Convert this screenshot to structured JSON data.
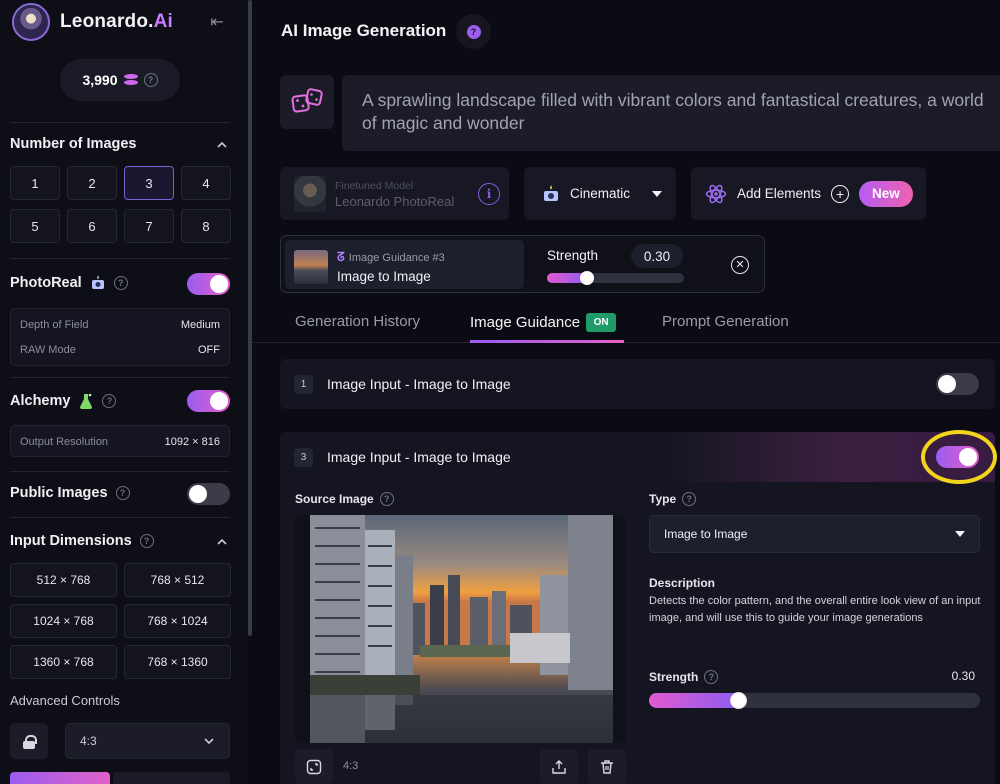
{
  "brand": {
    "name": "Leonardo.",
    "name_ai": "Ai"
  },
  "tokens": {
    "count": "3,990"
  },
  "sidebar": {
    "number_of_images": {
      "title": "Number of Images",
      "options": [
        "1",
        "2",
        "3",
        "4",
        "5",
        "6",
        "7",
        "8"
      ],
      "selected": "3"
    },
    "photoreal": {
      "title": "PhotoReal",
      "enabled": true,
      "settings": [
        {
          "label": "Depth of Field",
          "value": "Medium"
        },
        {
          "label": "RAW Mode",
          "value": "OFF"
        }
      ]
    },
    "alchemy": {
      "title": "Alchemy",
      "enabled": true,
      "settings": [
        {
          "label": "Output Resolution",
          "value": "1092 × 816"
        }
      ]
    },
    "public_images": {
      "title": "Public Images",
      "enabled": false
    },
    "input_dimensions": {
      "title": "Input Dimensions",
      "options": [
        "512 × 768",
        "768 × 512",
        "1024 × 768",
        "768 × 1024",
        "1360 × 768",
        "768 × 1360"
      ]
    },
    "advanced_controls": {
      "title": "Advanced Controls",
      "aspect_ratio": "4:3"
    }
  },
  "main": {
    "title": "AI Image Generation",
    "prompt": "A sprawling landscape filled with vibrant colors and fantastical creatures, a world of magic and wonder",
    "model": {
      "caption": "Finetuned Model",
      "name": "Leonardo PhotoReal"
    },
    "style": {
      "label": "Cinematic"
    },
    "elements": {
      "label": "Add Elements",
      "badge": "New"
    },
    "guidance_chip": {
      "subtitle": "Image Guidance #3",
      "name": "Image to Image",
      "strength_label": "Strength",
      "strength_value": "0.30",
      "strength_fraction": 0.25
    },
    "tabs": [
      {
        "label": "Generation History",
        "active": false
      },
      {
        "label": "Image Guidance",
        "active": true,
        "badge": "ON"
      },
      {
        "label": "Prompt Generation",
        "active": false
      }
    ],
    "inputs": [
      {
        "index": "1",
        "title": "Image Input - Image to Image",
        "enabled": false
      },
      {
        "index": "3",
        "title": "Image Input - Image to Image",
        "enabled": true
      }
    ],
    "detail": {
      "source_label": "Source Image",
      "aspect_ratio": "4:3",
      "type_label": "Type",
      "type_value": "Image to Image",
      "description_title": "Description",
      "description": "Detects the color pattern, and the overall entire look view of an input image, and will use this to guide your image generations",
      "strength_label": "Strength",
      "strength_value": "0.30",
      "strength_fraction": 0.25
    }
  },
  "colors": {
    "accent_purple": "#9b5cf0",
    "accent_pink": "#e261c8",
    "on_badge": "#1f9b6a",
    "highlight_ring": "#f2d41b"
  }
}
